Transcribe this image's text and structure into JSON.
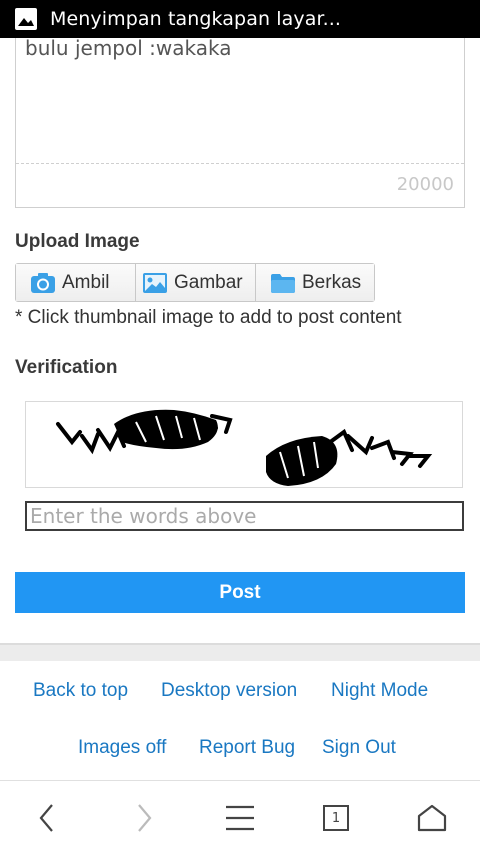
{
  "statusbar": {
    "text": "Menyimpan tangkapan layar..."
  },
  "editor": {
    "content": "bulu jempol :wakaka",
    "counter": "20000"
  },
  "upload": {
    "title": "Upload Image",
    "buttons": [
      {
        "label": "Ambil",
        "icon": "camera-icon"
      },
      {
        "label": "Gambar",
        "icon": "image-icon"
      },
      {
        "label": "Berkas",
        "icon": "folder-icon"
      }
    ],
    "hint": "* Click thumbnail image to add to post content"
  },
  "verification": {
    "title": "Verification",
    "placeholder": "Enter the words above"
  },
  "post": {
    "label": "Post"
  },
  "footer": {
    "links": [
      "Back to top",
      "Desktop version",
      "Night Mode",
      "Images off",
      "Report Bug",
      "Sign Out"
    ]
  },
  "navbar": {
    "tabs_count": "1"
  },
  "colors": {
    "accent": "#2196f3",
    "link": "#1a78c2"
  }
}
